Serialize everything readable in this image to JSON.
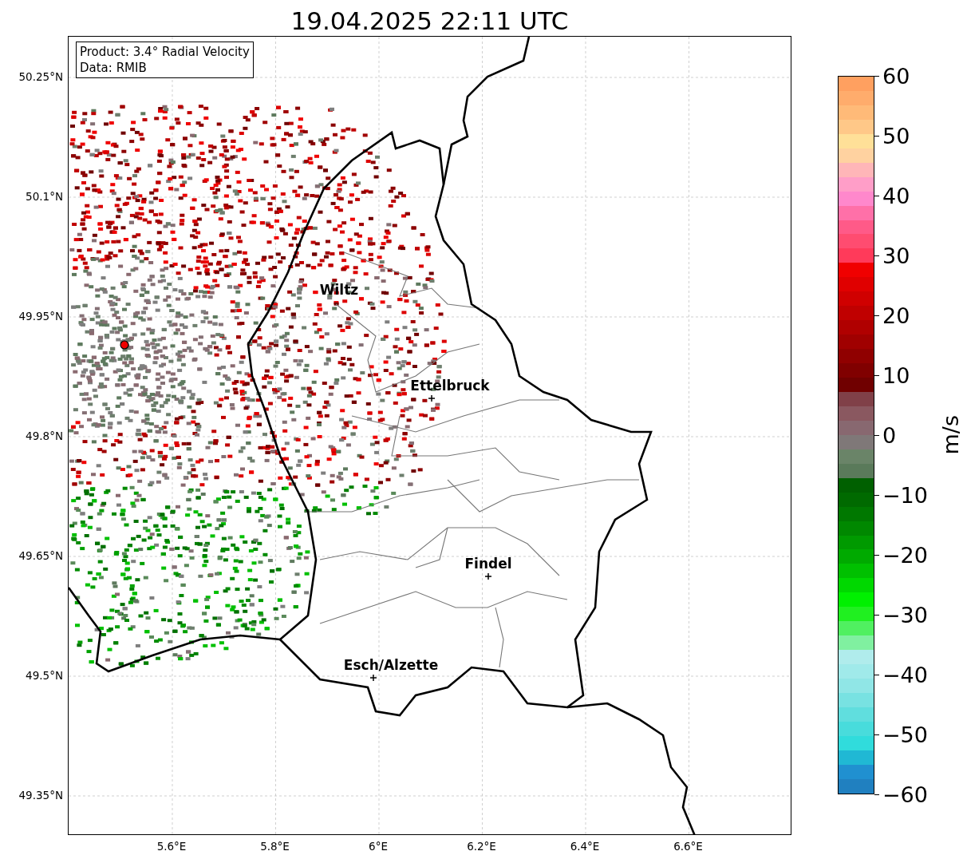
{
  "title": "19.04.2025 22:11 UTC",
  "info_box": {
    "lines": [
      "Product: 3.4° Radial Velocity",
      "Data: RMIB"
    ]
  },
  "map": {
    "cities": [
      {
        "name": "Wiltz",
        "marker": false
      },
      {
        "name": "Ettelbruck",
        "marker": true
      },
      {
        "name": "Findel",
        "marker": true
      },
      {
        "name": "Esch/Alzette",
        "marker": true
      }
    ],
    "y_ticks": [
      "50.25°N",
      "50.1°N",
      "49.95°N",
      "49.8°N",
      "49.65°N",
      "49.5°N",
      "49.35°N"
    ],
    "x_ticks": [
      "5.6°E",
      "5.8°E",
      "6°E",
      "6.2°E",
      "6.4°E",
      "6.6°E"
    ]
  },
  "colorbar": {
    "label": "m/s",
    "ticks": [
      "60",
      "50",
      "40",
      "30",
      "20",
      "10",
      "0",
      "−10",
      "−20",
      "−30",
      "−40",
      "−50",
      "−60"
    ]
  }
}
